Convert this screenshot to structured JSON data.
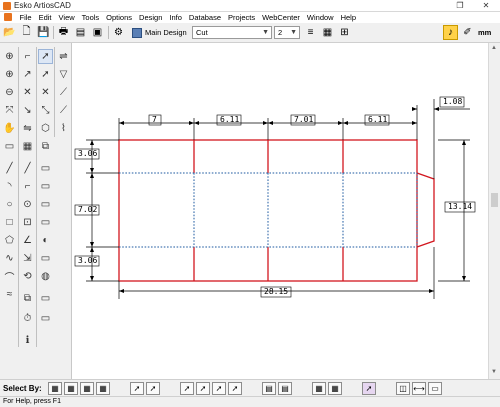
{
  "window": {
    "title": "Esko ArtiosCAD"
  },
  "menu": [
    "File",
    "Edit",
    "View",
    "Tools",
    "Options",
    "Design",
    "Info",
    "Database",
    "Projects",
    "WebCenter",
    "Window",
    "Help"
  ],
  "toolbar": {
    "design_label": "Main Design",
    "line_type": "Cut",
    "pointage": "2",
    "units": "mm"
  },
  "select_bar": {
    "label": "Select By:"
  },
  "status": {
    "help": "For Help, press F1"
  },
  "colors": {
    "cut": "#d2161e",
    "crease": "#1e5aa0",
    "dimension": "#000000"
  },
  "drawing": {
    "dimensions": {
      "panel1": "7",
      "panel2": "6.11",
      "panel3": "7.01",
      "panel4": "6.11",
      "glue_flap": "1.08",
      "top_flap": "3.06",
      "body": "7.02",
      "bottom_flap": "3.06",
      "height": "13.14",
      "overall": "28.15"
    }
  }
}
